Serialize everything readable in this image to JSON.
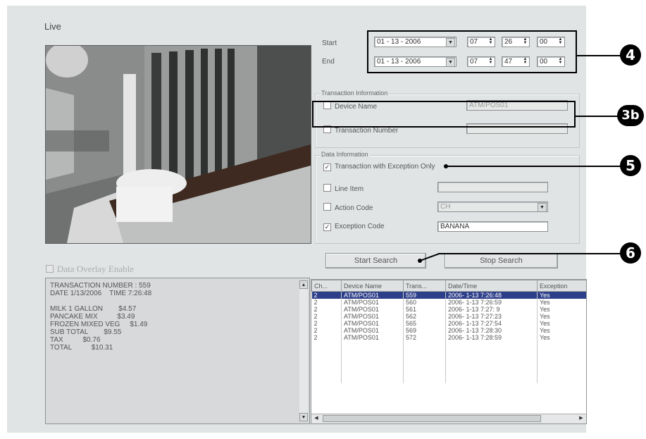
{
  "live": {
    "title": "Live"
  },
  "time_range": {
    "start_label": "Start",
    "end_label": "End",
    "start": {
      "date": "01 - 13 - 2006",
      "hour": "07",
      "minute": "26",
      "second": "00"
    },
    "end": {
      "date": "01 - 13 - 2006",
      "hour": "07",
      "minute": "47",
      "second": "00"
    }
  },
  "transaction_info": {
    "legend": "Transaction Information",
    "device_name_label": "Device Name",
    "device_name_checked": false,
    "device_name_value": "ATM/POS01",
    "transaction_number_label": "Transaction Number",
    "transaction_number_checked": false,
    "transaction_number_value": ""
  },
  "data_info": {
    "legend": "Data Information",
    "exception_only_label": "Transaction with Exception Only",
    "exception_only_checked": true,
    "line_item_label": "Line Item",
    "line_item_checked": false,
    "line_item_value": "",
    "action_code_label": "Action Code",
    "action_code_checked": false,
    "action_code_value": "CH",
    "exception_code_label": "Exception Code",
    "exception_code_checked": true,
    "exception_code_value": "BANANA"
  },
  "buttons": {
    "start_search": "Start Search",
    "stop_search": "Stop Search"
  },
  "overlay": {
    "label": "Data Overlay Enable",
    "checked": false,
    "lines": [
      "TRANSACTION NUMBER : 559",
      "DATE 1/13/2006    TIME 7:26:48",
      "",
      "MILK 1 GALLON        $4.57",
      "PANCAKE MIX          $3.49",
      "FROZEN MIXED VEG     $1.49",
      "SUB TOTAL        $9.55",
      "TAX          $0.76",
      "TOTAL          $10.31"
    ]
  },
  "results": {
    "columns": [
      "Ch...",
      "Device Name",
      "Trans...",
      "Date/Time",
      "Exception"
    ],
    "rows": [
      [
        "2",
        "ATM/POS01",
        "559",
        "2006- 1-13  7:26:48",
        "Yes"
      ],
      [
        "2",
        "ATM/POS01",
        "560",
        "2006- 1-13  7:26:59",
        "Yes"
      ],
      [
        "2",
        "ATM/POS01",
        "561",
        "2006- 1-13  7:27: 9",
        "Yes"
      ],
      [
        "2",
        "ATM/POS01",
        "562",
        "2006- 1-13  7:27:23",
        "Yes"
      ],
      [
        "2",
        "ATM/POS01",
        "565",
        "2006- 1-13  7:27:54",
        "Yes"
      ],
      [
        "2",
        "ATM/POS01",
        "569",
        "2006- 1-13  7:28:30",
        "Yes"
      ],
      [
        "2",
        "ATM/POS01",
        "572",
        "2006- 1-13  7:28:59",
        "Yes"
      ]
    ],
    "selected_row": 0
  },
  "callouts": {
    "c4": "4",
    "c3b": "3b",
    "c5": "5",
    "c6": "6"
  },
  "colors": {
    "panel": "#e1e4e5",
    "selection": "#2e3f8a",
    "callout": "#000000"
  }
}
